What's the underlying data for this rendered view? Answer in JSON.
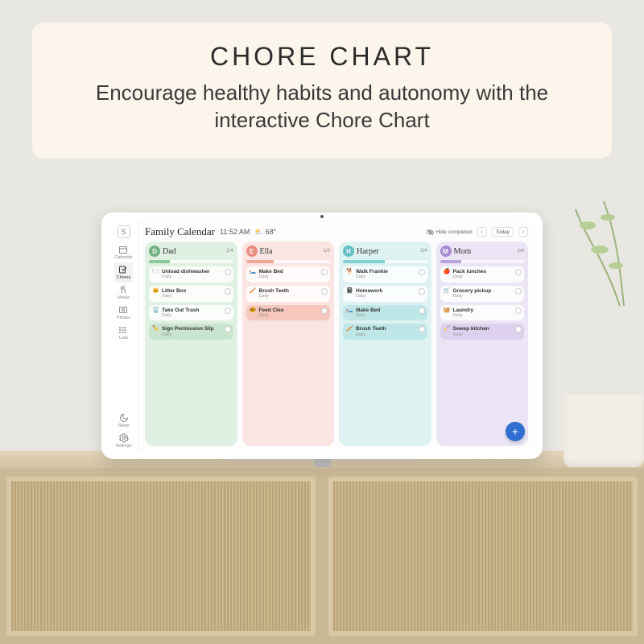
{
  "banner": {
    "title": "CHORE CHART",
    "subtitle": "Encourage healthy habits and autonomy with the interactive Chore Chart"
  },
  "rail": {
    "logo": "S",
    "items": [
      "Calendar",
      "Chores",
      "Meals",
      "Photos",
      "Lists"
    ],
    "bottom": [
      "Sleep",
      "Settings"
    ],
    "active": "Chores"
  },
  "header": {
    "app_title": "Family Calendar",
    "time": "11:52 AM",
    "temp": "68°",
    "hide_completed": "Hide completed",
    "today": "Today"
  },
  "columns": [
    {
      "name": "Dad",
      "initial": "D",
      "theme": "green",
      "count": "1/4",
      "progress": 25,
      "chores": [
        {
          "emoji": "🍽️",
          "title": "Unload dishwasher",
          "sub": "Daily",
          "tint": false
        },
        {
          "emoji": "🐱",
          "title": "Litter Box",
          "sub": "Daily",
          "tint": false
        },
        {
          "emoji": "🗑️",
          "title": "Take Out Trash",
          "sub": "Daily",
          "tint": false
        },
        {
          "emoji": "✏️",
          "title": "Sign Permission Slip",
          "sub": "Daily",
          "tint": true,
          "klass": "chore-green-t"
        }
      ]
    },
    {
      "name": "Ella",
      "initial": "E",
      "theme": "pink",
      "count": "1/3",
      "progress": 33,
      "chores": [
        {
          "emoji": "🛏️",
          "title": "Make Bed",
          "sub": "Daily",
          "tint": false
        },
        {
          "emoji": "🪥",
          "title": "Brush Teeth",
          "sub": "Daily",
          "tint": false
        },
        {
          "emoji": "🐠",
          "title": "Feed Cleo",
          "sub": "Daily",
          "tint": true,
          "klass": "chore-pink"
        }
      ]
    },
    {
      "name": "Harper",
      "initial": "H",
      "theme": "teal",
      "count": "2/4",
      "progress": 50,
      "chores": [
        {
          "emoji": "🐕",
          "title": "Walk Frankie",
          "sub": "Daily",
          "tint": false
        },
        {
          "emoji": "📓",
          "title": "Homework",
          "sub": "Daily",
          "tint": false
        },
        {
          "emoji": "🛏️",
          "title": "Make Bed",
          "sub": "Daily",
          "tint": true,
          "klass": "chore-teal"
        },
        {
          "emoji": "🪥",
          "title": "Brush Teeth",
          "sub": "Daily",
          "tint": true,
          "klass": "chore-teal"
        }
      ]
    },
    {
      "name": "Mom",
      "initial": "M",
      "theme": "purple",
      "count": "1/4",
      "progress": 25,
      "chores": [
        {
          "emoji": "🍎",
          "title": "Pack lunches",
          "sub": "Daily",
          "tint": false
        },
        {
          "emoji": "🛒",
          "title": "Grocery pickup",
          "sub": "Daily",
          "tint": false
        },
        {
          "emoji": "🧺",
          "title": "Laundry",
          "sub": "Daily",
          "tint": false
        },
        {
          "emoji": "🧹",
          "title": "Sweep kitchen",
          "sub": "Daily",
          "tint": true,
          "klass": "chore-purple"
        }
      ]
    }
  ]
}
